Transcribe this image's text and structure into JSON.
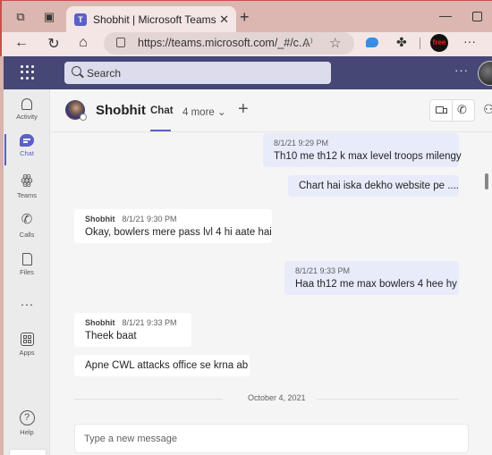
{
  "browser": {
    "tab_title": "Shobhit | Microsoft Teams",
    "tab_logo": "T",
    "url": "https://teams.microsoft.com/_#/c...",
    "close_glyph": "✕",
    "new_tab_glyph": "+",
    "min_glyph": "—",
    "back_glyph": "←",
    "refresh_glyph": "↻",
    "home_glyph": "⌂",
    "read_aloud_glyph": "A⁾",
    "favorite_glyph": "☆",
    "extensions_glyph": "✤",
    "free_badge": "free",
    "more_glyph": "···"
  },
  "teams": {
    "search_placeholder": "Search",
    "top_more": "···",
    "rail": [
      {
        "id": "activity",
        "label": "Activity"
      },
      {
        "id": "chat",
        "label": "Chat",
        "active": true
      },
      {
        "id": "teams",
        "label": "Teams"
      },
      {
        "id": "calls",
        "label": "Calls"
      },
      {
        "id": "files",
        "label": "Files"
      },
      {
        "id": "more",
        "label": "···"
      },
      {
        "id": "apps",
        "label": "Apps"
      },
      {
        "id": "help",
        "label": "Help"
      }
    ],
    "rail_glyphs": {
      "teams": "ꙮ",
      "calls": "✆",
      "help": "?"
    },
    "header": {
      "name": "Shobhit",
      "tab_chat": "Chat",
      "more_tabs": "4 more ⌄",
      "add_glyph": "+",
      "phone_glyph": "✆",
      "people_glyph": "⚇"
    },
    "messages": [
      {
        "sender": "me",
        "time": "8/1/21 9:29 PM",
        "text": "Th10 me th12 k max level troops milengy"
      },
      {
        "sender": "me",
        "text": "Chart hai iska dekho website pe ...."
      },
      {
        "sender": "Shobhit",
        "author": "Shobhit",
        "time": "8/1/21 9:30 PM",
        "text": "Okay, bowlers mere pass lvl 4 hi aate hai"
      },
      {
        "sender": "me",
        "time": "8/1/21 9:33 PM",
        "text": "Haa th12 me max bowlers 4 hee hy"
      },
      {
        "sender": "Shobhit",
        "author": "Shobhit",
        "time": "8/1/21 9:33 PM",
        "text": "Theek baat"
      },
      {
        "sender": "Shobhit",
        "text": "Apne CWL attacks office se krna ab"
      }
    ],
    "date_divider": "October 4, 2021",
    "compose_placeholder": "Type a new message"
  }
}
